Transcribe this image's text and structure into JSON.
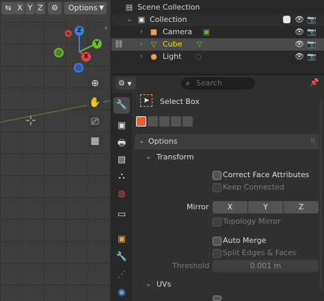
{
  "viewport": {
    "axis_toggles": [
      "X",
      "Y",
      "Z"
    ],
    "options_label": "Options",
    "gizmo": {
      "z": "Z",
      "y": "Y",
      "x": "X"
    },
    "colors": {
      "x": "#e04545",
      "y": "#6fba2c",
      "z": "#3b7ee0"
    }
  },
  "outliner": {
    "scene_collection": "Scene Collection",
    "collection": "Collection",
    "objects": [
      {
        "name": "Camera",
        "icon": "camera-icon",
        "selected": false
      },
      {
        "name": "Cube",
        "icon": "mesh-icon",
        "selected": true
      },
      {
        "name": "Light",
        "icon": "light-icon",
        "selected": false
      }
    ],
    "selected_color": "#f7e000"
  },
  "properties": {
    "search_placeholder": "Search",
    "tool_name": "Select Box",
    "options_panel": "Options",
    "transform_section": "Transform",
    "correct_face_attributes": "Correct Face Attributes",
    "keep_connected": "Keep Connected",
    "mirror_label": "Mirror",
    "mirror_axes": [
      "X",
      "Y",
      "Z"
    ],
    "topology_mirror": "Topology Mirror",
    "auto_merge": "Auto Merge",
    "split_edges_faces": "Split Edges & Faces",
    "threshold_label": "Threshold",
    "threshold_value": "0.001 m",
    "uvs_section": "UVs"
  }
}
